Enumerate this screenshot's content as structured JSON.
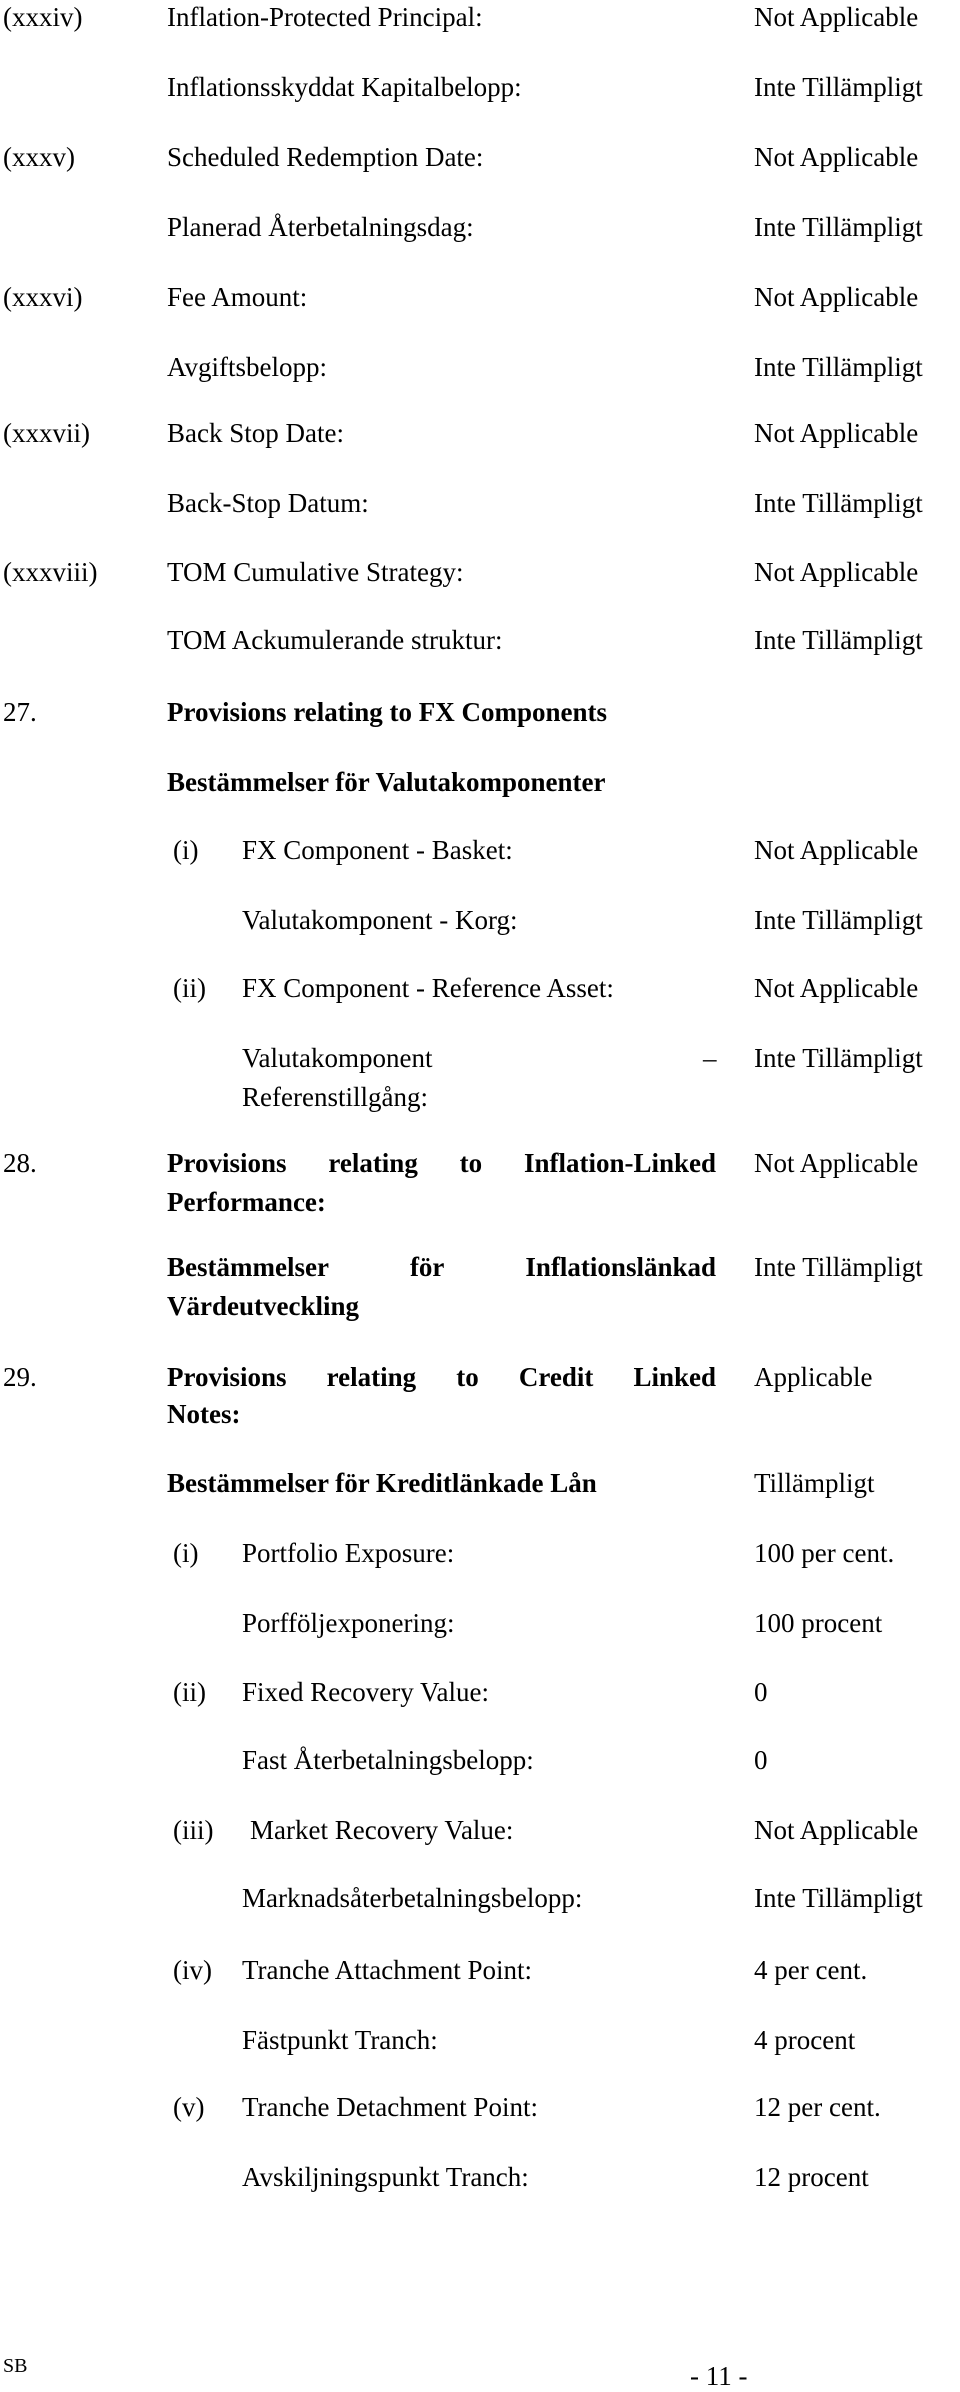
{
  "page": {
    "items_top": [
      {
        "num": "(xxxiv)",
        "label": "Inflation-Protected Principal:",
        "value": "Not Applicable",
        "label_sv": "Inflationsskyddat Kapitalbelopp:",
        "value_sv": "Inte Tillämpligt"
      },
      {
        "num": "(xxxv)",
        "label": "Scheduled Redemption Date:",
        "value": "Not Applicable",
        "label_sv": "Planerad Återbetalningsdag:",
        "value_sv": "Inte Tillämpligt"
      },
      {
        "num": "(xxxvi)",
        "label": "Fee Amount:",
        "value": "Not Applicable",
        "label_sv": "Avgiftsbelopp:",
        "value_sv": "Inte Tillämpligt"
      },
      {
        "num": "(xxxvii)",
        "label": "Back Stop Date:",
        "value": "Not Applicable",
        "label_sv": "Back-Stop Datum:",
        "value_sv": "Inte Tillämpligt"
      },
      {
        "num": "(xxxviii)",
        "label": "TOM Cumulative Strategy:",
        "value": "Not Applicable",
        "label_sv": "TOM Ackumulerande struktur:",
        "value_sv": "Inte Tillämpligt"
      }
    ],
    "section27": {
      "num": "27.",
      "heading": "Provisions relating to FX Components",
      "heading_sv": "Bestämmelser för Valutakomponenter",
      "items": [
        {
          "num": "(i)",
          "label": "FX Component -  Basket:",
          "value": "Not Applicable",
          "label_sv": "Valutakomponent - Korg:",
          "value_sv": "Inte Tillämpligt"
        },
        {
          "num": "(ii)",
          "label": "FX Component - Reference Asset:",
          "value": "Not Applicable",
          "label_sv_line1": "Valutakomponent",
          "label_sv_dash": "–",
          "label_sv_line2": "Referenstillgång:",
          "value_sv": "Inte Tillämpligt"
        }
      ]
    },
    "section28": {
      "num": "28.",
      "heading_line1": "Provisions relating to Inflation-Linked",
      "heading_line2": "Performance:",
      "value": "Not Applicable",
      "heading_sv_line1": "Bestämmelser för Inflationslänkad",
      "heading_sv_line2": "Värdeutveckling",
      "value_sv": "Inte Tillämpligt"
    },
    "section29": {
      "num": "29.",
      "heading_line1": "Provisions relating to Credit Linked",
      "heading_line2": "Notes:",
      "value": "Applicable",
      "heading_sv": "Bestämmelser för Kreditlänkade Lån",
      "value_sv": "Tillämpligt",
      "items": [
        {
          "num": "(i)",
          "label": "Portfolio Exposure:",
          "value": "100 per cent.",
          "label_sv": "Porfföljexponering:",
          "value_sv": "100 procent"
        },
        {
          "num": "(ii)",
          "label": "Fixed Recovery Value:",
          "value": "0",
          "label_sv": "Fast Återbetalningsbelopp:",
          "value_sv": "0"
        },
        {
          "num": "(iii)",
          "label": "Market Recovery Value:",
          "value": "Not Applicable",
          "label_sv": "Marknadsåterbetalningsbelopp:",
          "value_sv": "Inte Tillämpligt"
        },
        {
          "num": "(iv)",
          "label": "Tranche Attachment Point:",
          "value": "4 per cent.",
          "label_sv": "Fästpunkt Tranch:",
          "value_sv": "4 procent"
        },
        {
          "num": "(v)",
          "label": "Tranche Detachment Point:",
          "value": "12 per cent.",
          "label_sv": "Avskiljningspunkt Tranch:",
          "value_sv": "12 procent"
        }
      ]
    },
    "footer": {
      "initials": "SB",
      "page_number": "- 11 -"
    }
  }
}
